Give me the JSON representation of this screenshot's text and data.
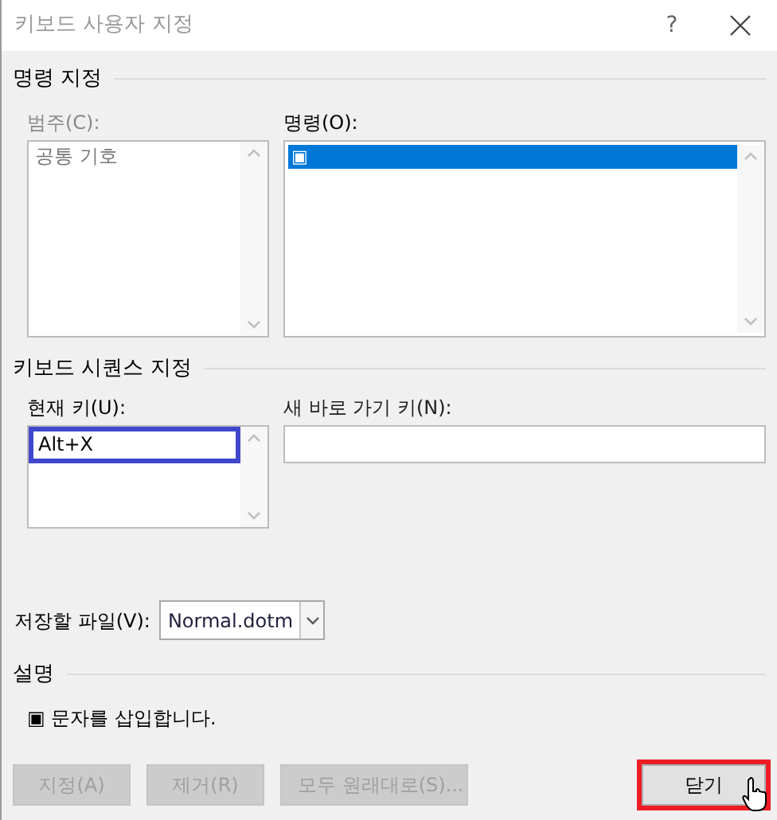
{
  "window": {
    "title": "키보드 사용자 지정",
    "help": "?"
  },
  "command_section": {
    "title": "명령 지정",
    "categories": {
      "label": "범주(C):",
      "disabled": true,
      "items": [
        {
          "label": "공통 기호",
          "selected": false
        }
      ]
    },
    "commands": {
      "label": "명령(O):",
      "items": [
        {
          "label": "▣",
          "selected": true
        }
      ]
    }
  },
  "keyboard_section": {
    "title": "키보드 시퀀스 지정",
    "current_keys": {
      "label": "현재 키(U):",
      "items": [
        {
          "label": "Alt+X",
          "selected": true
        }
      ]
    },
    "new_shortcut": {
      "label": "새 바로 가기 키(N):"
    }
  },
  "save_in": {
    "label": "저장할 파일(V):",
    "value": "Normal.dotm"
  },
  "description": {
    "title": "설명",
    "text": "▣ 문자를 삽입합니다."
  },
  "buttons": [
    {
      "label": "지정(A)",
      "disabled": true,
      "highlighted": false
    },
    {
      "label": "제거(R)",
      "disabled": true,
      "highlighted": false
    },
    {
      "label": "모두 원래대로(S)...",
      "disabled": true,
      "highlighted": false
    },
    {
      "label": "닫기",
      "disabled": false,
      "highlighted": true
    }
  ]
}
